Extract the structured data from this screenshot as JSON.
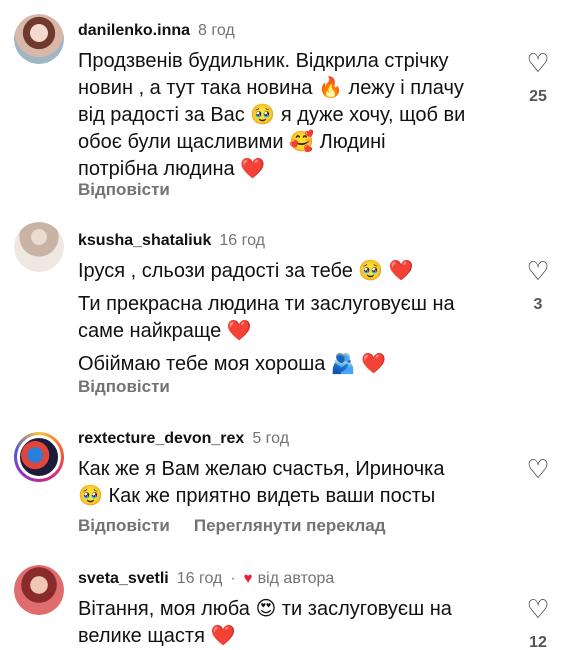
{
  "comments": [
    {
      "username": "danilenko.inna",
      "time": "8 год",
      "lines": [
        "Продзвенів будильник. Відкрила стрічку",
        "новин , а тут така новина 🔥 лежу і плачу",
        "від радості за Вас 🥹 я дуже хочу, щоб ви",
        "обоє були щасливими 🥰 Людині",
        "потрібна людина ❤️"
      ],
      "reply_label": "Відповісти",
      "likes": "25"
    },
    {
      "username": "ksusha_shataliuk",
      "time": "16 год",
      "lines": [
        "Іруся , сльози радості за тебе 🥹 ❤️",
        "Ти прекрасна людина ти заслуговуєш на",
        "саме найкраще ❤️",
        "Обіймаю тебе моя хороша 🫂 ❤️"
      ],
      "reply_label": "Відповісти",
      "likes": "3"
    },
    {
      "username": "rextecture_devon_rex",
      "time": "5 год",
      "lines": [
        "Как же я Вам желаю счастья, Ириночка",
        "🥹 Как же приятно видеть ваши посты"
      ],
      "reply_label": "Відповісти",
      "translate_label": "Переглянути переклад"
    },
    {
      "username": "sveta_svetli",
      "time": "16 год",
      "author_badge": "від автора",
      "lines": [
        "Вітання, моя люба 😍 ти заслуговуєш на",
        "велике щастя ❤️"
      ],
      "likes": "12"
    }
  ],
  "icons": {
    "like": "heart-outline-icon",
    "author_like": "heart-filled-icon"
  },
  "colors": {
    "text": "#111111",
    "muted": "#737373",
    "heart": "#ed1d3a"
  }
}
